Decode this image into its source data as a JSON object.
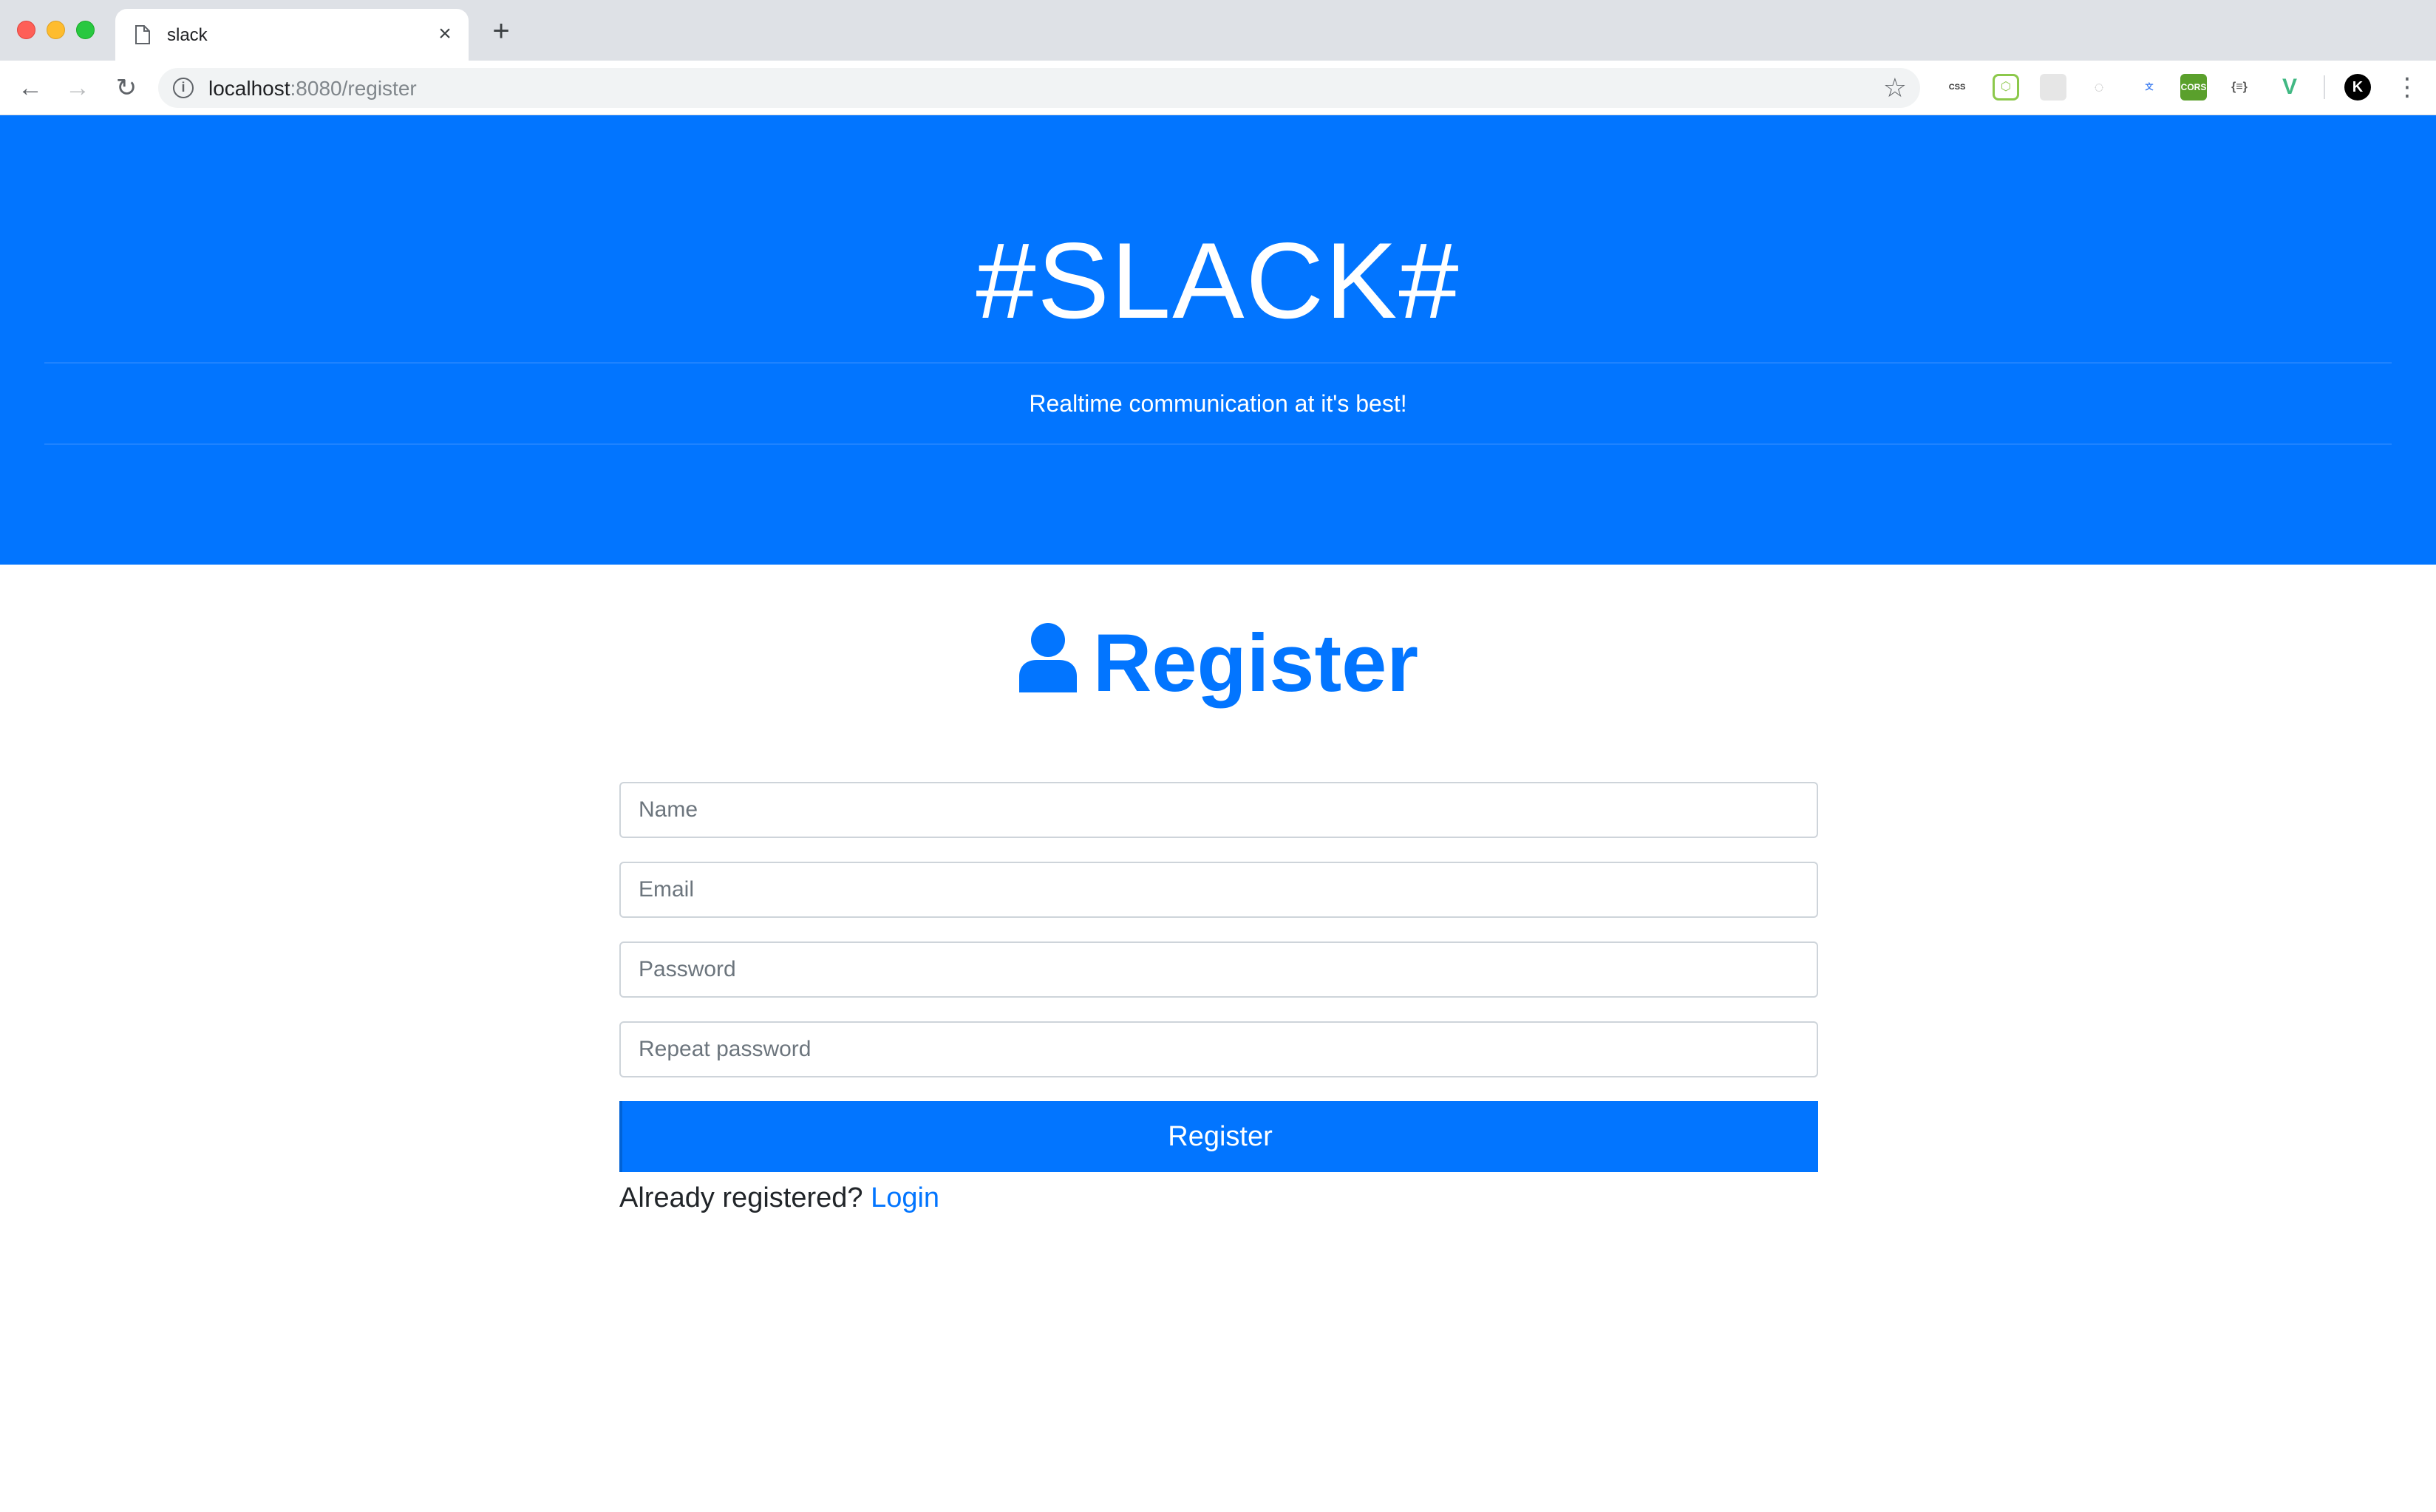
{
  "browser": {
    "tab_title": "slack",
    "tab_close": "×",
    "new_tab": "+",
    "url_host": "localhost",
    "url_path": ":8080/register",
    "star": "☆",
    "menu": "⋮",
    "nav": {
      "back": "←",
      "forward": "→",
      "reload": "↻"
    },
    "extensions": [
      {
        "name": "css-peeper-icon",
        "label": "CSS"
      },
      {
        "name": "nodejs-icon",
        "label": "⬡"
      },
      {
        "name": "grid-icon",
        "label": ""
      },
      {
        "name": "dial-icon",
        "label": "◌"
      },
      {
        "name": "translate-icon",
        "label": "文"
      },
      {
        "name": "cors-icon",
        "label": "CORS"
      },
      {
        "name": "json-icon",
        "label": "{≡}"
      },
      {
        "name": "vue-devtools-icon",
        "label": "V"
      },
      {
        "name": "profile-avatar-icon",
        "label": "K"
      }
    ]
  },
  "header": {
    "brand": "#SLACK#",
    "tagline": "Realtime communication at it's best!"
  },
  "register": {
    "heading": "Register",
    "fields": {
      "name_placeholder": "Name",
      "email_placeholder": "Email",
      "password_placeholder": "Password",
      "repeat_placeholder": "Repeat password"
    },
    "submit_label": "Register",
    "already_text": "Already registered?",
    "login_link": "Login"
  },
  "colors": {
    "primary": "#0275ff",
    "chrome_bg": "#dee1e6"
  }
}
